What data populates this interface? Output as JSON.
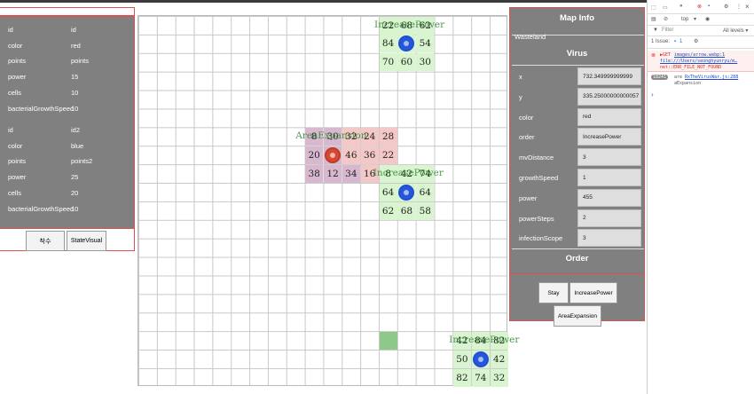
{
  "left_panel": {
    "virus1": [
      {
        "k": "id",
        "v": "id"
      },
      {
        "k": "color",
        "v": "red"
      },
      {
        "k": "points",
        "v": "points"
      },
      {
        "k": "power",
        "v": "15"
      },
      {
        "k": "cells",
        "v": "10"
      },
      {
        "k": "bacterialGrowthSpeed",
        "v": "10"
      }
    ],
    "virus2": [
      {
        "k": "id",
        "v": "id2"
      },
      {
        "k": "color",
        "v": "blue"
      },
      {
        "k": "points",
        "v": "points2"
      },
      {
        "k": "power",
        "v": "25"
      },
      {
        "k": "cells",
        "v": "20"
      },
      {
        "k": "bacterialGrowthSpeed",
        "v": "10"
      }
    ],
    "buttons": {
      "surrender": "착수",
      "state_visual": "StateVisual"
    }
  },
  "grid": {
    "labels": {
      "top": "IncreasePower",
      "middle_red": "AreaExpansion",
      "middle_blue": "IncreasePower",
      "bottom": "IncreasePower"
    },
    "top_cluster": [
      "22",
      "68",
      "62",
      "84",
      "",
      "54",
      "70",
      "60",
      "30"
    ],
    "red_cluster": [
      "8",
      "30",
      "32",
      "24",
      "28",
      "20",
      "",
      "46",
      "36",
      "22",
      "38",
      "12",
      "34",
      "16"
    ],
    "blue_mid_cluster": [
      "8",
      "42",
      "74",
      "64",
      "",
      "64",
      "62",
      "68",
      "58"
    ],
    "bottom_cluster": [
      "42",
      "84",
      "82",
      "50",
      "",
      "42",
      "82",
      "74",
      "32"
    ]
  },
  "map_info": {
    "title": "Map Info",
    "terrain": "Wasteland",
    "virus_title": "Virus",
    "fields": [
      {
        "k": "x",
        "v": "732.349999999999"
      },
      {
        "k": "y",
        "v": "335.25000000000057"
      },
      {
        "k": "color",
        "v": "red"
      },
      {
        "k": "order",
        "v": "IncreasePower"
      },
      {
        "k": "mvDistance",
        "v": "3"
      },
      {
        "k": "growthSpeed",
        "v": "1"
      },
      {
        "k": "power",
        "v": "455"
      },
      {
        "k": "powerSteps",
        "v": "2"
      },
      {
        "k": "infectionScope",
        "v": "3"
      }
    ],
    "order_title": "Order",
    "orders": {
      "stay": "Stay",
      "increase_power": "IncreasePower",
      "area_expansion": "AreaExpansion"
    }
  },
  "devtools": {
    "context": "top",
    "filter_placeholder": "Filter",
    "levels": "All levels ▾",
    "issues": "1 Issue:",
    "issues_count": "1",
    "error_get": "▶GET",
    "error_url": "images/arrow.webp:1",
    "error_file": "file:///Users/seonghyunryu/m…",
    "error_msg": "net::ERR_FILE_NOT_FOUND",
    "log_count": "18241",
    "log_text": "are",
    "log_source": "RxTheVirusWar.js:288",
    "log_tail": "aExpansion",
    "prompt": "›"
  }
}
